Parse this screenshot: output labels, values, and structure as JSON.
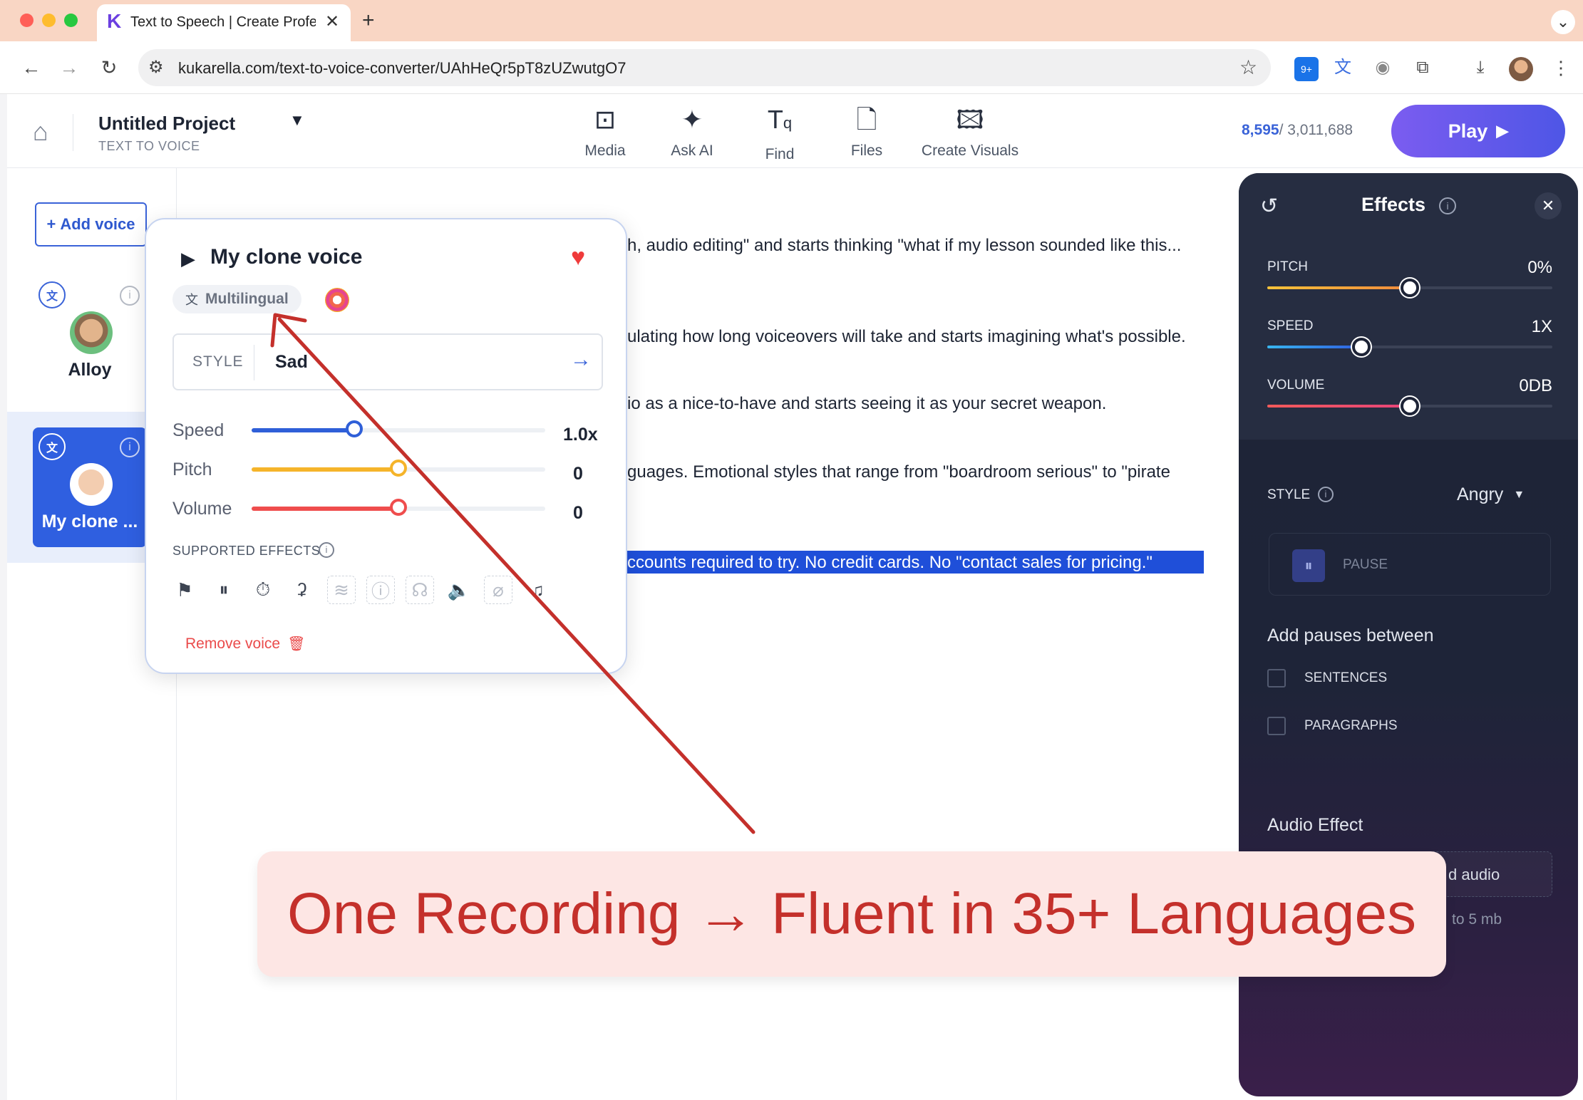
{
  "browser": {
    "tab_title": "Text to Speech | Create Profe",
    "url": "kukarella.com/text-to-voice-converter/UAhHeQr5pT8zUZwutgO7",
    "extension_badge": "9+"
  },
  "header": {
    "project_title": "Untitled Project",
    "project_subtitle": "TEXT TO VOICE",
    "tools": [
      "Media",
      "Ask AI",
      "Find",
      "Files",
      "Create Visuals"
    ],
    "credits_used": "8,595",
    "credits_total": "/ 3,011,688",
    "play_label": "Play"
  },
  "sidebar": {
    "add_voice": "Add voice",
    "voices": [
      {
        "name": "Alloy"
      },
      {
        "name": "My clone ..."
      }
    ]
  },
  "editor": {
    "lines": [
      "h, audio editing\" and starts thinking \"what if my lesson sounded like this...",
      "ulating how long voiceovers will take and starts imagining what's possible.",
      "io as a nice-to-have and starts seeing it as your secret weapon.",
      "guages. Emotional styles that range from \"boardroom serious\" to \"pirate",
      "ccounts required to try. No credit cards. No \"contact sales for pricing.\""
    ]
  },
  "voice_popup": {
    "title": "My clone voice",
    "tag": "Multilingual",
    "style_label": "STYLE",
    "style_value": "Sad",
    "sliders": [
      {
        "label": "Speed",
        "value": "1.0x",
        "level": 0.35,
        "color": "#2f5fd8"
      },
      {
        "label": "Pitch",
        "value": "0",
        "level": 0.5,
        "color": "#f5b42a"
      },
      {
        "label": "Volume",
        "value": "0",
        "level": 0.5,
        "color": "#ef4d4d"
      }
    ],
    "supported_effects_label": "SUPPORTED EFFECTS",
    "remove_label": "Remove voice"
  },
  "effects_panel": {
    "title": "Effects",
    "sliders": [
      {
        "label": "PITCH",
        "value": "0%",
        "level": 0.5
      },
      {
        "label": "SPEED",
        "value": "1X",
        "level": 0.33
      },
      {
        "label": "VOLUME",
        "value": "0DB",
        "level": 0.5
      }
    ],
    "style_label": "STYLE",
    "style_value": "Angry",
    "pause_label": "PAUSE",
    "pauses_heading": "Add pauses between",
    "checkboxes": [
      "SENTENCES",
      "PARAGRAPHS"
    ],
    "audio_effect_heading": "Audio Effect",
    "upload_label": "d audio",
    "upload_hint": "to 5 mb"
  },
  "caption": {
    "text": "One Recording → Fluent in 35+ Languages"
  },
  "colors": {
    "accent": "#3a63d8",
    "caption_text": "#c4302b",
    "caption_bg": "#fde6e4",
    "arrow": "#c4302b",
    "highlight": "#1f4fd9"
  }
}
